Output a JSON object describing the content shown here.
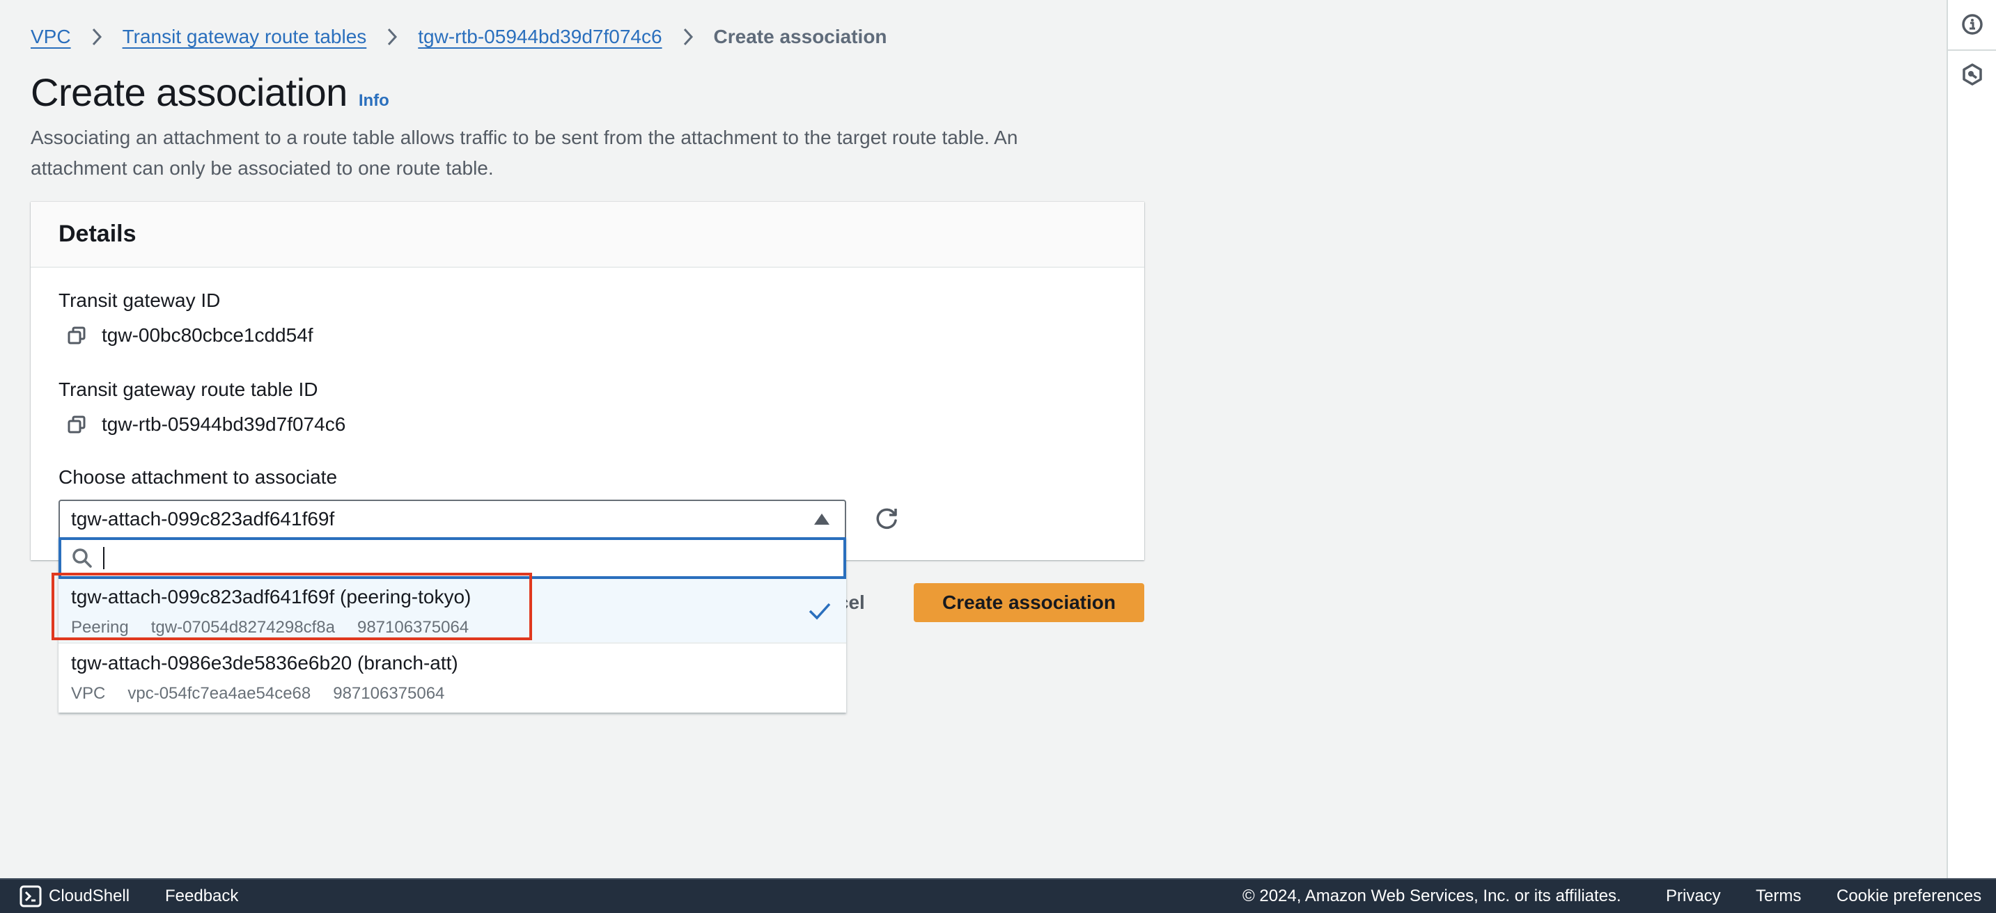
{
  "breadcrumb": {
    "items": [
      {
        "label": "VPC"
      },
      {
        "label": "Transit gateway route tables"
      },
      {
        "label": "tgw-rtb-05944bd39d7f074c6"
      }
    ],
    "current": "Create association"
  },
  "header": {
    "title": "Create association",
    "info_label": "Info",
    "description": "Associating an attachment to a route table allows traffic to be sent from the attachment to the target route table. An attachment can only be associated to one route table."
  },
  "details": {
    "heading": "Details",
    "transit_gateway_id_label": "Transit gateway ID",
    "transit_gateway_id": "tgw-00bc80cbce1cdd54f",
    "route_table_id_label": "Transit gateway route table ID",
    "route_table_id": "tgw-rtb-05944bd39d7f074c6",
    "attachment_label": "Choose attachment to associate",
    "attachment_selected": "tgw-attach-099c823adf641f69f",
    "search_value": "",
    "options": [
      {
        "title": "tgw-attach-099c823adf641f69f (peering-tokyo)",
        "type": "Peering",
        "resource": "tgw-07054d8274298cf8a",
        "account": "987106375064",
        "selected": true
      },
      {
        "title": "tgw-attach-0986e3de5836e6b20 (branch-att)",
        "type": "VPC",
        "resource": "vpc-054fc7ea4ae54ce68",
        "account": "987106375064",
        "selected": false
      }
    ]
  },
  "actions": {
    "cancel_label": "Cancel",
    "create_label": "Create association"
  },
  "colors": {
    "link": "#2a6fbd",
    "primary_button": "#ec9b36",
    "highlight_box": "#e0391f",
    "footer_bg": "#232f3e"
  },
  "footer": {
    "cloudshell": "CloudShell",
    "feedback": "Feedback",
    "copyright": "© 2024, Amazon Web Services, Inc. or its affiliates.",
    "privacy": "Privacy",
    "terms": "Terms",
    "cookie": "Cookie preferences"
  },
  "rail": {
    "icons": [
      "info-icon",
      "security-hexagon-icon"
    ]
  }
}
